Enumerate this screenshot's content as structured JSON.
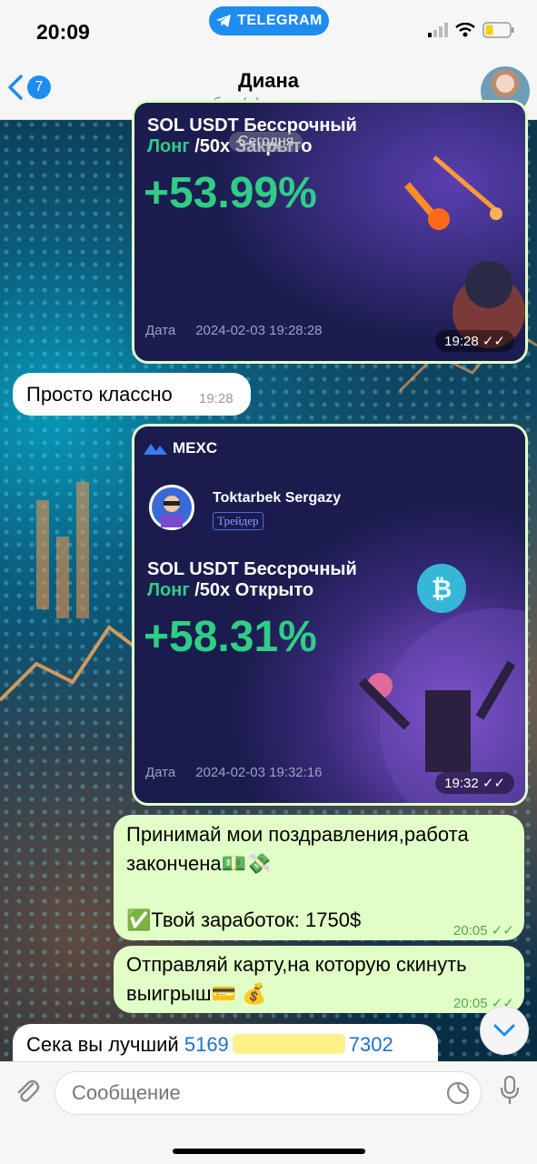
{
  "status_bar": {
    "time": "20:09",
    "app_pill": "TELEGRAM"
  },
  "header": {
    "back_badge": "7",
    "name": "Диана",
    "status": "был(а) недавно"
  },
  "messages": {
    "card1": {
      "title_line1": "SOL USDT Бессрочный",
      "title_line2_green": "Лонг",
      "title_line2_rest": " /50х Закрыто",
      "overlay_label": "Сегодня",
      "percent": "+53.99%",
      "date_label": "Дата",
      "date_value": "2024-02-03 19:28:28",
      "time": "19:28"
    },
    "text1": {
      "text": "Просто классно",
      "time": "19:28"
    },
    "card2": {
      "brand": "MEXC",
      "trader_name": "Toktarbek Sergazy",
      "trader_badge": "Трейдер",
      "title_line1": "SOL USDT Бессрочный",
      "title_line2_green": "Лонг",
      "title_line2_rest": " /50x Открыто",
      "percent": "+58.31%",
      "date_label": "Дата",
      "date_value": "2024-02-03 19:32:16",
      "time": "19:32"
    },
    "out1": {
      "line1": "Принимай мои поздравления,работа",
      "line2": "закончена💵💸",
      "line3": "✅Твой заработок: 1750$",
      "time": "20:05"
    },
    "out2": {
      "line1": "Отправляй карту,на которую скинуть",
      "line2": "выигрыш💳 💰",
      "time": "20:05"
    },
    "text2": {
      "text": "Сека вы лучший ",
      "card_start": "5169",
      "card_end": "7302"
    }
  },
  "input": {
    "placeholder": "Сообщение"
  },
  "colors": {
    "accent": "#1f8cf0",
    "outgoing_bubble": "#e1fec6",
    "profit_green": "#2fce86"
  }
}
